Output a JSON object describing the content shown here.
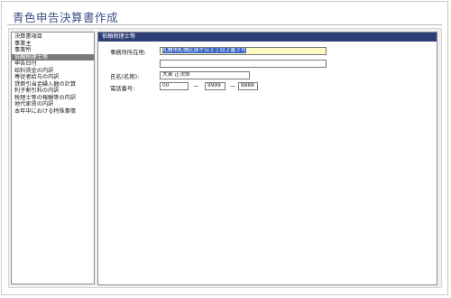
{
  "window": {
    "title": "青色申告決算書作成"
  },
  "sidebar": {
    "items": [
      {
        "label": "決算書項目"
      },
      {
        "label": "事業主"
      },
      {
        "label": "事業所"
      },
      {
        "label": "依頼税理士等",
        "selected": true
      },
      {
        "label": "申告日付"
      },
      {
        "label": "給料賃金の内訳"
      },
      {
        "label": "専従者給与の内訳"
      },
      {
        "label": "貸倒引当金繰入額の計算"
      },
      {
        "label": "利子割引料の内訳"
      },
      {
        "label": "税理士等の報酬等の内訳"
      },
      {
        "label": "地代家賃の内訳"
      },
      {
        "label": "本年中における特殊事情"
      }
    ]
  },
  "form": {
    "header": "依頼税理士等",
    "office_address_label": "事務所所在地:",
    "office_address_line1": "札幌市札幌区原ケ丘１丁目２番３号",
    "office_address_line2": "",
    "name_label": "氏名(名称):",
    "name_value": "大東 正次郎",
    "phone_label": "電話番号:",
    "phone_area": "00",
    "phone_exchange": "9999",
    "phone_number": "8888",
    "phone_separator": "—"
  },
  "colors": {
    "title": "#3d4f86",
    "header_bg": "#2e3f78",
    "selected_bg": "#7a7a7a",
    "focused_field_bg": "#fffbc4",
    "text_selection": "#3a66c8"
  }
}
